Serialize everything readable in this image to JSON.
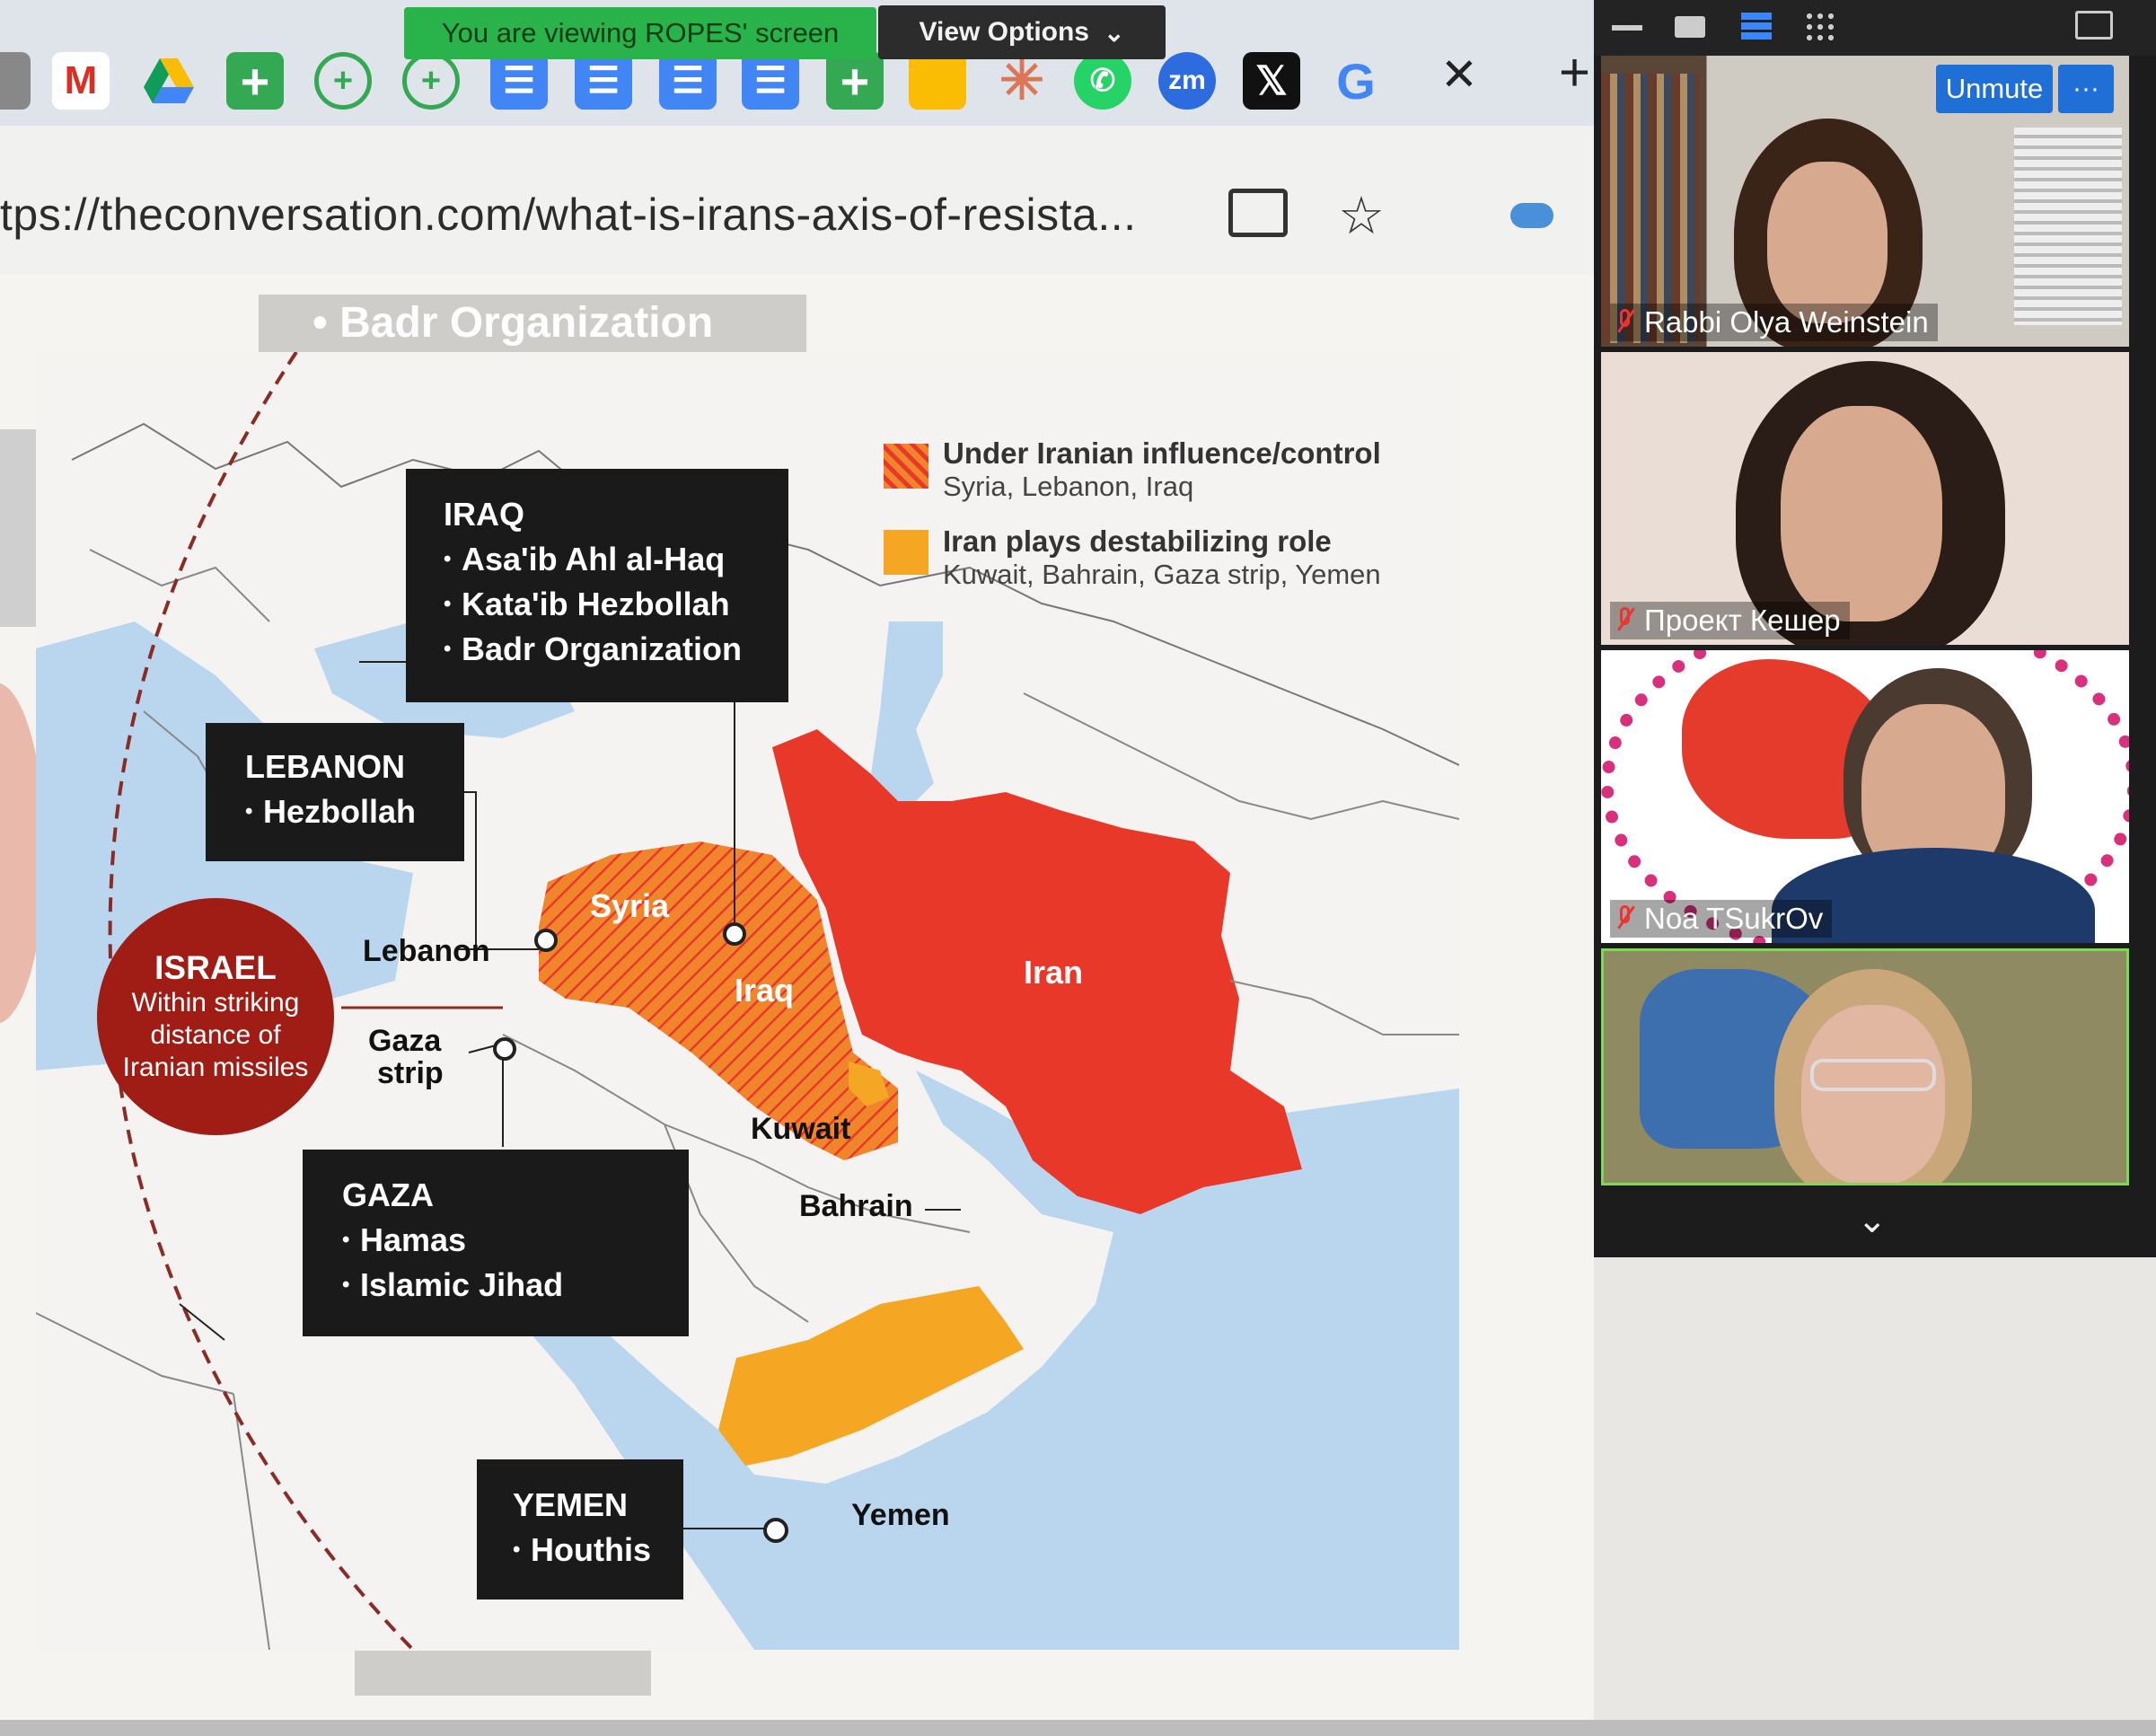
{
  "zoom": {
    "share_banner": "You are viewing ROPES' screen",
    "view_options": "View Options",
    "view_options_icon": "chevron-down-icon",
    "unmute_label": "Unmute",
    "more_label": "···",
    "participants": [
      {
        "name": "Rabbi Olya Weinstein",
        "muted": true
      },
      {
        "name": "Проект Кешер",
        "muted": true
      },
      {
        "name": "Noa TSukrOv",
        "muted": true
      },
      {
        "name": "",
        "muted": false
      }
    ],
    "gallery_chevron": "⌄"
  },
  "browser": {
    "url": "tps://theconversation.com/what-is-irans-axis-of-resista...",
    "close_label": "✕",
    "new_tab_label": "+",
    "bookmark_icons": [
      "chrome-icon",
      "gmail-icon",
      "google-drive-icon",
      "green-plus-icon",
      "green-circle-plus-icon",
      "green-circle-plus-icon",
      "docs-icon",
      "docs-icon",
      "docs-icon",
      "docs-icon",
      "green-plus-icon",
      "keep-icon",
      "claude-icon",
      "whatsapp-icon",
      "zoom-icon",
      "x-icon",
      "google-icon"
    ],
    "star_icon": "☆"
  },
  "slide": {
    "top_caption": "• Badr Organization",
    "legend": [
      {
        "title": "Under Iranian influence/control",
        "sub": "Syria, Lebanon, Iraq",
        "color": "#f0852c"
      },
      {
        "title": "Iran plays destabilizing role",
        "sub": "Kuwait, Bahrain, Gaza strip, Yemen",
        "color": "#f5a623"
      }
    ],
    "boxes": {
      "iraq": {
        "title": "IRAQ",
        "items": [
          "Asa'ib Ahl al-Haq",
          "Kata'ib Hezbollah",
          "Badr Organization"
        ]
      },
      "lebanon": {
        "title": "LEBANON",
        "items": [
          "Hezbollah"
        ]
      },
      "gaza": {
        "title": "GAZA",
        "items": [
          "Hamas",
          "Islamic Jihad"
        ]
      },
      "yemen": {
        "title": "YEMEN",
        "items": [
          "Houthis"
        ]
      }
    },
    "israel": {
      "title": "ISRAEL",
      "sub": "Within striking distance of Iranian missiles"
    },
    "countries": {
      "syria": "Syria",
      "iraq": "Iraq",
      "iran": "Iran",
      "yemen": "Yemen",
      "lebanon": "Lebanon",
      "gaza_line1": "Gaza",
      "gaza_line2": "strip",
      "kuwait": "Kuwait",
      "bahrain": "Bahrain"
    },
    "colors": {
      "iran": "#e8382a",
      "influence": "#f0852c",
      "destabilizing": "#f5a623",
      "sea": "#b9d6ee",
      "land": "#f4f3f1"
    }
  }
}
